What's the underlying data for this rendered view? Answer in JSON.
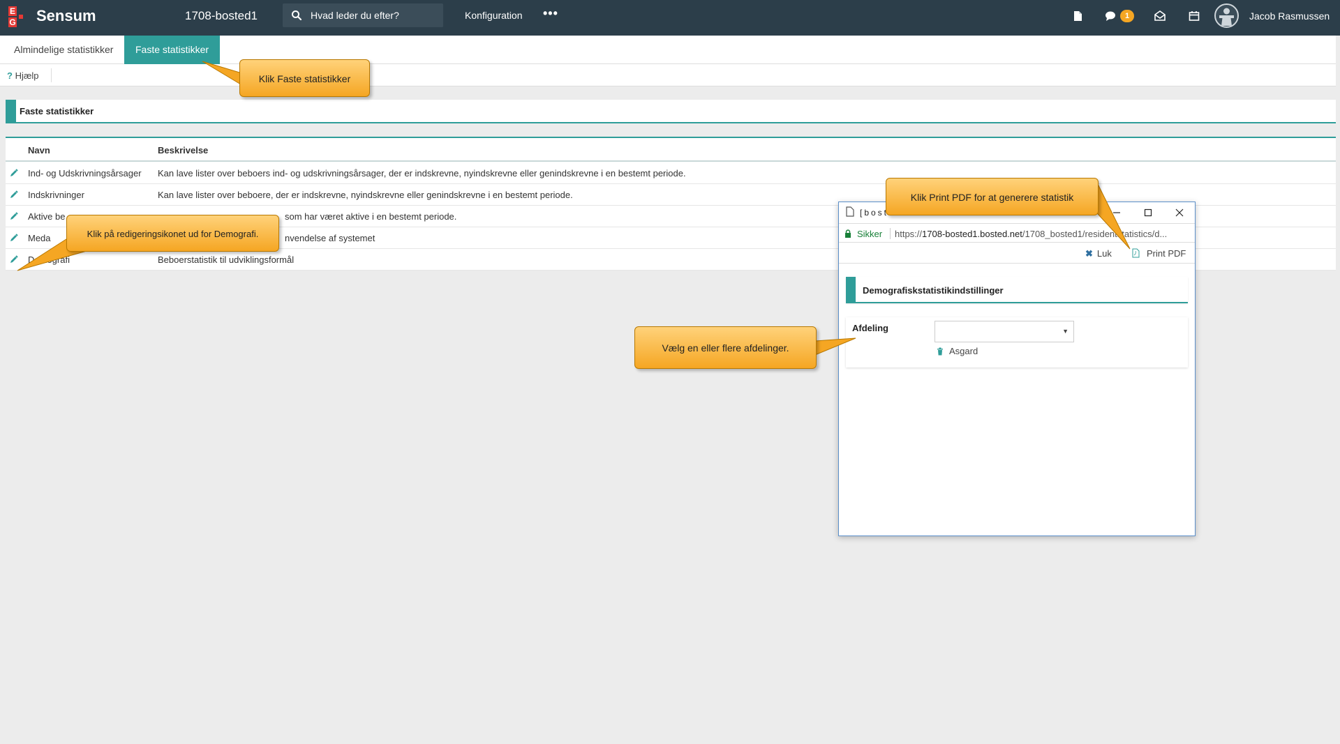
{
  "header": {
    "brand": "Sensum",
    "logo_letters": [
      "E",
      "G"
    ],
    "site": "1708-bosted1",
    "search_placeholder": "Hvad leder du efter?",
    "config_label": "Konfiguration",
    "more_label": "•••",
    "notification_count": "1",
    "user_name": "Jacob Rasmussen",
    "icons": [
      "document-icon",
      "chat-icon",
      "mail-icon",
      "calendar-icon",
      "avatar"
    ]
  },
  "tabs": [
    {
      "label": "Almindelige statistikker",
      "active": false
    },
    {
      "label": "Faste statistikker",
      "active": true
    }
  ],
  "subbar": {
    "help_mark": "?",
    "help_label": "Hjælp"
  },
  "section_title": "Faste statistikker",
  "table": {
    "columns": [
      "Navn",
      "Beskrivelse"
    ],
    "rows": [
      {
        "name": "Ind- og Udskrivningsårsager",
        "desc": "Kan lave lister over beboers ind- og udskrivningsårsager, der er indskrevne, nyindskrevne eller genindskrevne i en bestemt periode."
      },
      {
        "name": "Indskrivninger",
        "desc": "Kan lave lister over beboere, der er indskrevne, nyindskrevne eller genindskrevne i en bestemt periode."
      },
      {
        "name": "Aktive be",
        "desc": "som har været aktive i en bestemt periode."
      },
      {
        "name": "Meda",
        "desc": "nvendelse af systemet"
      },
      {
        "name": "Demografi",
        "desc": "Beboerstatistik til udviklingsformål"
      }
    ]
  },
  "popup": {
    "title_text": "[bost",
    "secure_label": "Sikker",
    "url_scheme": "https://",
    "url_host": "1708-bosted1.bosted.net",
    "url_path": "/1708_bosted1/residentstatistics/d...",
    "close_label": "Luk",
    "print_label": "Print PDF",
    "section_title": "Demografiskstatistikindstillinger",
    "field_label": "Afdeling",
    "select_value": "",
    "department": "Asgard"
  },
  "callouts": {
    "tab": "Klik Faste statistikker",
    "edit": "Klik på redigeringsikonet ud for Demografi.",
    "print": "Klik Print PDF for at generere statistik",
    "dept": "Vælg en eller flere afdelinger."
  },
  "colors": {
    "topbar": "#2c3e4a",
    "accent": "#2f9d99",
    "callout": "#f5a623",
    "badge": "#f5a623"
  }
}
